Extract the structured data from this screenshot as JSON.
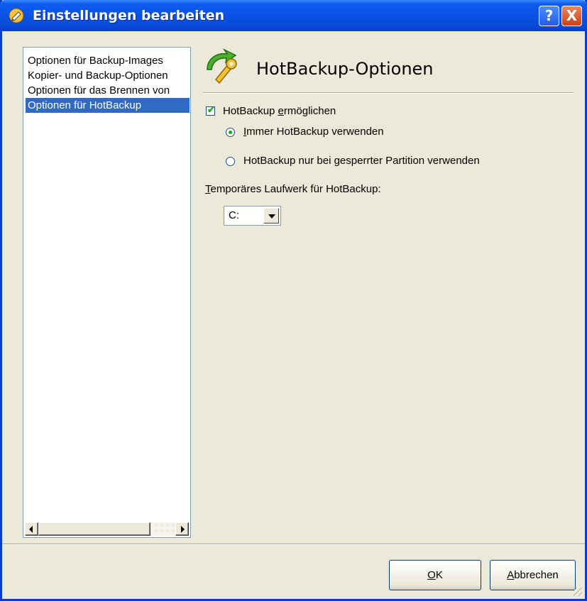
{
  "window": {
    "title": "Einstellungen bearbeiten",
    "help_label": "?",
    "close_label": "X"
  },
  "nav": {
    "items": [
      {
        "label": "Optionen für Backup-Images",
        "selected": false
      },
      {
        "label": "Kopier- und Backup-Optionen",
        "selected": false
      },
      {
        "label": "Optionen für das Brennen von",
        "selected": false
      },
      {
        "label": "Optionen für HotBackup",
        "selected": true
      }
    ]
  },
  "panel": {
    "title": "HotBackup-Optionen",
    "icon": "hotbackup-wrench-icon",
    "enable_checkbox": {
      "label_pre": "HotBackup ",
      "label_ul": "e",
      "label_post": "rmöglichen",
      "checked": true
    },
    "radio_always": {
      "label_ul": "I",
      "label_post": "mmer HotBackup verwenden",
      "selected": true
    },
    "radio_locked": {
      "label_pre": "HotBackup nur bei ",
      "label_ul": "g",
      "label_post": "esperrter Partition verwenden",
      "selected": false
    },
    "drive_label": {
      "label_ul": "T",
      "label_post": "emporäres Laufwerk für HotBackup:"
    },
    "drive_value": "C:"
  },
  "buttons": {
    "ok": {
      "label_ul": "O",
      "label_post": "K"
    },
    "cancel": {
      "label_ul": "A",
      "label_post": "bbrechen"
    }
  },
  "colors": {
    "selection": "#316ac5",
    "check_mark": "#21a121",
    "titlebar": "#0a52e6"
  }
}
